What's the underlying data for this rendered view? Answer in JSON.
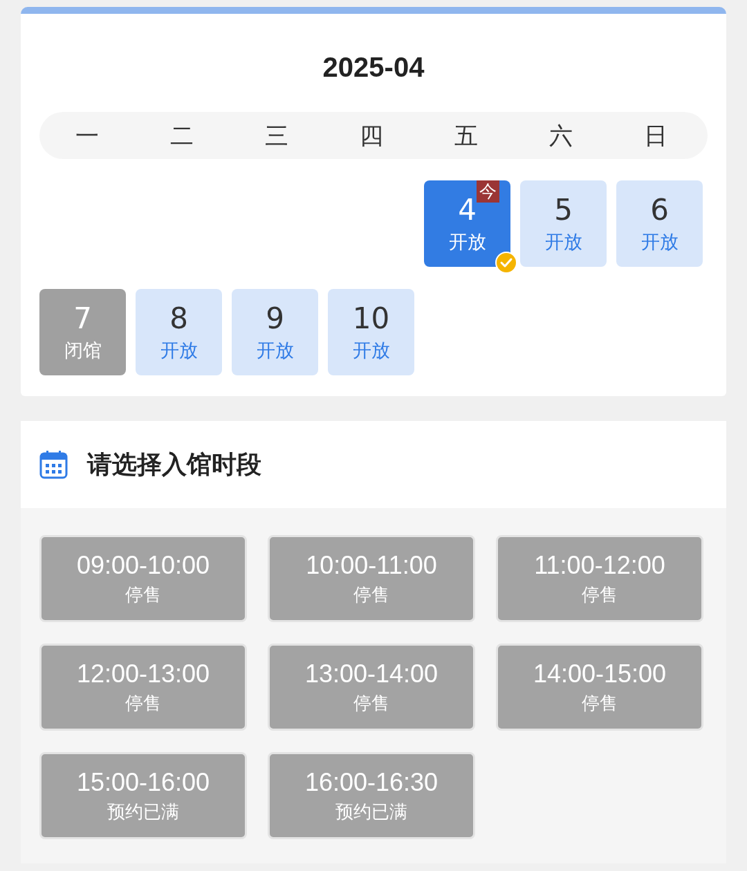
{
  "calendar": {
    "title": "2025-04",
    "weekdays": [
      "一",
      "二",
      "三",
      "四",
      "五",
      "六",
      "日"
    ],
    "days": [
      {
        "day": "4",
        "status": "开放",
        "kind": "open",
        "selected": true,
        "today": true,
        "today_label": "今"
      },
      {
        "day": "5",
        "status": "开放",
        "kind": "open",
        "selected": false,
        "today": false
      },
      {
        "day": "6",
        "status": "开放",
        "kind": "open",
        "selected": false,
        "today": false
      },
      {
        "day": "7",
        "status": "闭馆",
        "kind": "closed",
        "selected": false,
        "today": false
      },
      {
        "day": "8",
        "status": "开放",
        "kind": "open",
        "selected": false,
        "today": false
      },
      {
        "day": "9",
        "status": "开放",
        "kind": "open",
        "selected": false,
        "today": false
      },
      {
        "day": "10",
        "status": "开放",
        "kind": "open",
        "selected": false,
        "today": false
      }
    ]
  },
  "time_slots": {
    "title": "请选择入馆时段",
    "slots": [
      {
        "time": "09:00-10:00",
        "status": "停售"
      },
      {
        "time": "10:00-11:00",
        "status": "停售"
      },
      {
        "time": "11:00-12:00",
        "status": "停售"
      },
      {
        "time": "12:00-13:00",
        "status": "停售"
      },
      {
        "time": "13:00-14:00",
        "status": "停售"
      },
      {
        "time": "14:00-15:00",
        "status": "停售"
      },
      {
        "time": "15:00-16:00",
        "status": "预约已满"
      },
      {
        "time": "16:00-16:30",
        "status": "预约已满"
      }
    ]
  }
}
